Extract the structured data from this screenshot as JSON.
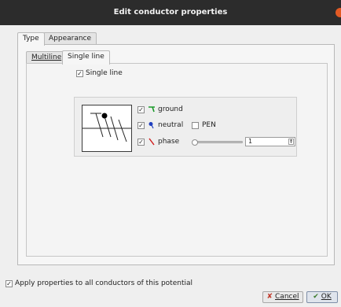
{
  "window": {
    "title": "Edit conductor properties"
  },
  "outer_tabs": [
    {
      "label": "Type",
      "active": true
    },
    {
      "label": "Appearance",
      "active": false
    }
  ],
  "inner_tabs": [
    {
      "label": "Multiline",
      "active": false
    },
    {
      "label": "Single line",
      "active": true
    }
  ],
  "single_line": {
    "checkbox_label": "Single line",
    "checked": true,
    "options": {
      "ground": {
        "label": "ground",
        "checked": true,
        "icon": "ground-icon",
        "color": "#1a9a2a"
      },
      "neutral": {
        "label": "neutral",
        "checked": true,
        "icon": "neutral-icon",
        "color": "#1f3fbf"
      },
      "pen": {
        "label": "PEN",
        "checked": false
      },
      "phase": {
        "label": "phase",
        "checked": true,
        "icon": "phase-icon",
        "color": "#d01818",
        "count": "1"
      }
    },
    "phase_slider_level": 0
  },
  "footer": {
    "apply_label": "Apply properties to all conductors of this potential",
    "apply_checked": true,
    "cancel_label": "Cancel",
    "cancel_icon": "cancel-icon",
    "ok_label": "OK",
    "ok_icon": "ok-icon"
  }
}
